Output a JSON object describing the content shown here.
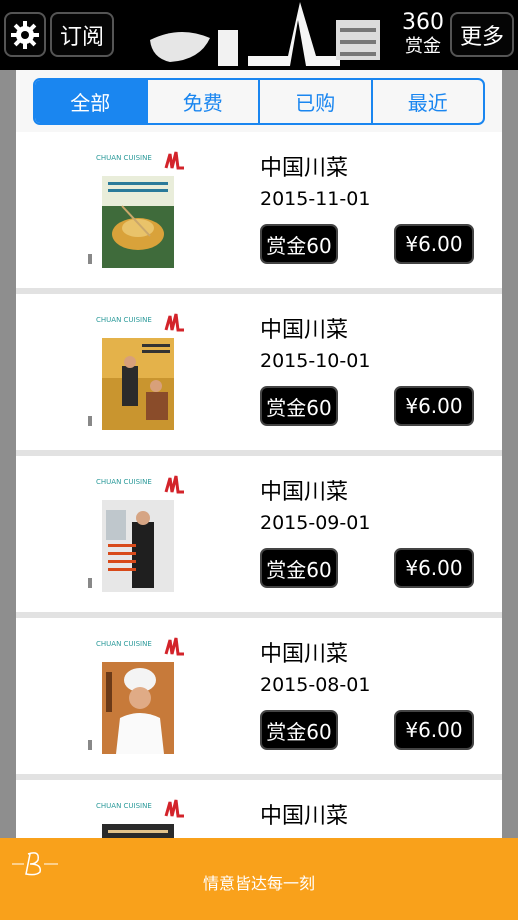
{
  "header": {
    "subscribe_label": "订阅",
    "reward_count": "360",
    "reward_label": "赏金",
    "more_label": "更多",
    "icons": {
      "settings": "gear-icon",
      "logo": "app-logo"
    }
  },
  "tabs": [
    {
      "label": "全部",
      "active": true
    },
    {
      "label": "免费",
      "active": false
    },
    {
      "label": "已购",
      "active": false
    },
    {
      "label": "最近",
      "active": false
    }
  ],
  "magazines": [
    {
      "title": "中国川菜",
      "date": "2015-11-01",
      "reward": "赏金60",
      "price": "¥6.00",
      "cover_brand": "CHUAN CUISINE"
    },
    {
      "title": "中国川菜",
      "date": "2015-10-01",
      "reward": "赏金60",
      "price": "¥6.00",
      "cover_brand": "CHUAN CUISINE"
    },
    {
      "title": "中国川菜",
      "date": "2015-09-01",
      "reward": "赏金60",
      "price": "¥6.00",
      "cover_brand": "CHUAN CUISINE"
    },
    {
      "title": "中国川菜",
      "date": "2015-08-01",
      "reward": "赏金60",
      "price": "¥6.00",
      "cover_brand": "CHUAN CUISINE"
    },
    {
      "title": "中国川菜",
      "date": "",
      "reward": "",
      "price": "",
      "cover_brand": "CHUAN CUISINE"
    }
  ],
  "ad": {
    "text": "情意皆达每一刻"
  },
  "colors": {
    "accent": "#1a86f0",
    "ad_bg": "#f9a11b",
    "header_bg": "#000000"
  }
}
